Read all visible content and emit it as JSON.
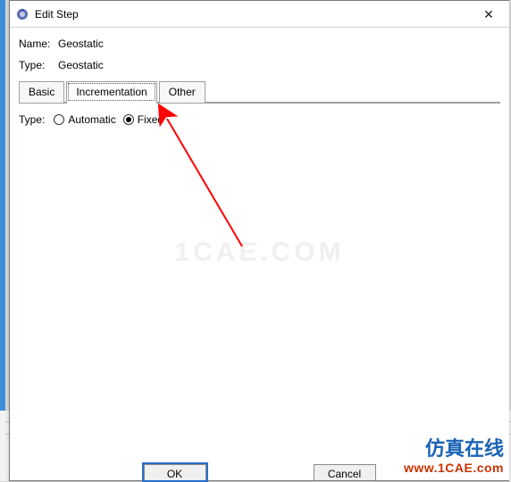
{
  "window": {
    "title": "Edit Step",
    "close_label": "✕"
  },
  "fields": {
    "name_label": "Name:",
    "name_value": "Geostatic",
    "type_label": "Type:",
    "type_value": "Geostatic"
  },
  "tabs": {
    "basic": "Basic",
    "incrementation": "Incrementation",
    "other": "Other",
    "active": "incrementation"
  },
  "inc_panel": {
    "type_label": "Type:",
    "options": {
      "automatic": "Automatic",
      "fixed": "Fixed"
    },
    "selected": "fixed"
  },
  "buttons": {
    "ok": "OK",
    "cancel": "Cancel"
  },
  "watermark": "1CAE.COM",
  "branding": {
    "cn": "仿真在线",
    "url": "www.1CAE.com"
  }
}
